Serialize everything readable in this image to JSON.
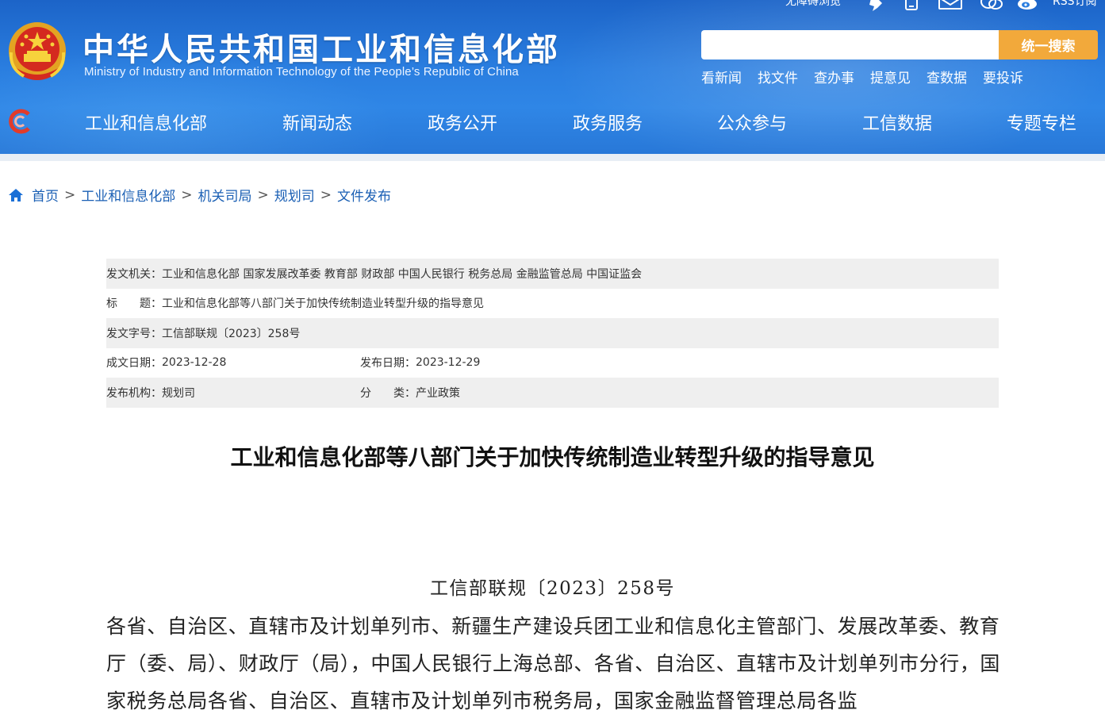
{
  "header": {
    "title": "中华人民共和国工业和信息化部",
    "subtitle": "Ministry of Industry and Information Technology of the People’s Republic of China",
    "top_tools": {
      "accessibility": "无障碍浏览",
      "rss": "RSS订阅"
    },
    "search": {
      "placeholder": "",
      "button": "统一搜索"
    },
    "quick_links": [
      "看新闻",
      "找文件",
      "查办事",
      "提意见",
      "查数据",
      "要投诉"
    ],
    "nav": [
      "工业和信息化部",
      "新闻动态",
      "政务公开",
      "政务服务",
      "公众参与",
      "工信数据",
      "专题专栏"
    ],
    "colors": {
      "header_blue": "#2a7ee0",
      "search_orange": "#f2a93b"
    }
  },
  "breadcrumb": [
    "首页",
    "工业和信息化部",
    "机关司局",
    "规划司",
    "文件发布"
  ],
  "meta": {
    "issuer_label": "发文机关：",
    "issuer": "工业和信息化部 国家发展改革委 教育部 财政部 中国人民银行 税务总局 金融监管总局 中国证监会",
    "title_label": "标　　题：",
    "title": "工业和信息化部等八部门关于加快传统制造业转型升级的指导意见",
    "doc_no_label": "发文字号：",
    "doc_no": "工信部联规〔2023〕258号",
    "created_label": "成文日期：",
    "created": "2023-12-28",
    "published_label": "发布日期：",
    "published": "2023-12-29",
    "org_label": "发布机构：",
    "org": "规划司",
    "category_label": "分　　类：",
    "category": "产业政策"
  },
  "article": {
    "title": "工业和信息化部等八部门关于加快传统制造业转型升级的指导意见",
    "doc_number": "工信部联规〔2023〕258号",
    "body": "各省、自治区、直辖市及计划单列市、新疆生产建设兵团工业和信息化主管部门、发展改革委、教育厅（委、局）、财政厅（局），中国人民银行上海总部、各省、自治区、直辖市及计划单列市分行，国家税务总局各省、自治区、直辖市及计划单列市税务局，国家金融监督管理总局各监"
  }
}
